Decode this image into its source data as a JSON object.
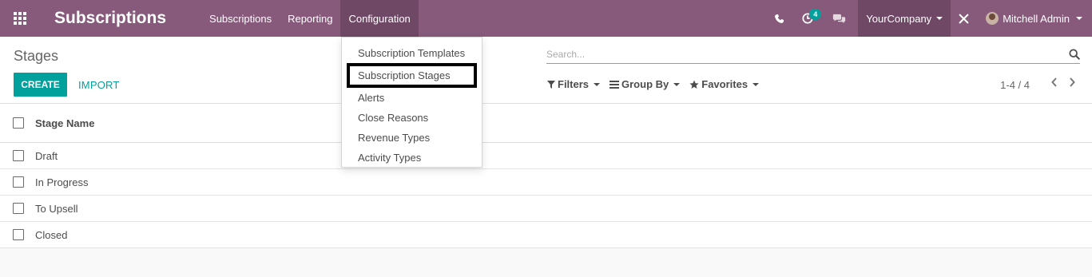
{
  "navbar": {
    "app_title": "Subscriptions",
    "menu": [
      {
        "label": "Subscriptions"
      },
      {
        "label": "Reporting"
      },
      {
        "label": "Configuration"
      }
    ],
    "activity_count": "4",
    "company": "YourCompany",
    "user": "Mitchell Admin",
    "bg_color": "#875a7b",
    "active_color": "#6e4864"
  },
  "control_panel": {
    "breadcrumb": "Stages",
    "create_label": "CREATE",
    "import_label": "IMPORT",
    "search_placeholder": "Search...",
    "filters_label": "Filters",
    "groupby_label": "Group By",
    "favorites_label": "Favorites",
    "pager": "1-4 / 4"
  },
  "list": {
    "column_header": "Stage Name",
    "rows": [
      "Draft",
      "In Progress",
      "To Upsell",
      "Closed"
    ]
  },
  "configuration_menu": {
    "items": [
      "Subscription Templates",
      "Subscription Stages",
      "Alerts",
      "Close Reasons",
      "Revenue Types",
      "Activity Types"
    ]
  },
  "colors": {
    "primary": "#00a09d",
    "brand": "#875a7b"
  }
}
